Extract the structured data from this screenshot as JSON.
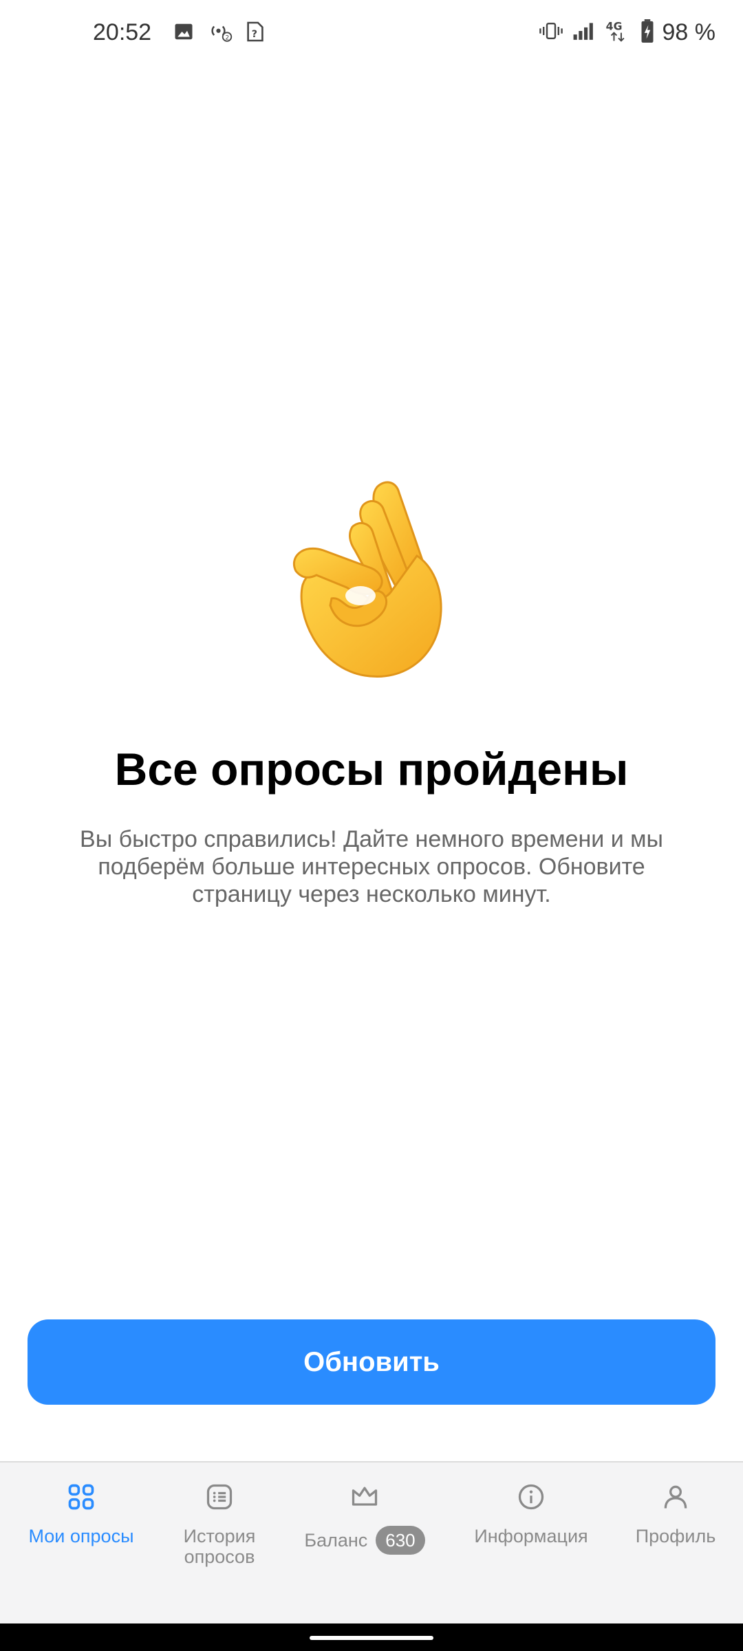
{
  "status_bar": {
    "time": "20:52",
    "battery": "98 %",
    "network": "4G"
  },
  "content": {
    "emoji_icon": "ok-hand-emoji",
    "title": "Все опросы пройдены",
    "subtitle": "Вы быстро справились! Дайте немного времени и мы подберём больше интересных опросов. Обновите страницу через несколько минут."
  },
  "actions": {
    "refresh_label": "Обновить"
  },
  "nav": {
    "items": [
      {
        "label": "Мои опросы",
        "icon": "grid-icon",
        "active": true
      },
      {
        "label": "История\nопросов",
        "icon": "list-icon",
        "active": false
      },
      {
        "label": "Баланс",
        "icon": "crown-icon",
        "badge": "630",
        "active": false
      },
      {
        "label": "Информация",
        "icon": "info-icon",
        "active": false
      },
      {
        "label": "Профиль",
        "icon": "person-icon",
        "active": false
      }
    ]
  },
  "colors": {
    "accent": "#2a8cff",
    "nav_inactive": "#8a8a8a",
    "badge_bg": "#8e8e8e"
  }
}
